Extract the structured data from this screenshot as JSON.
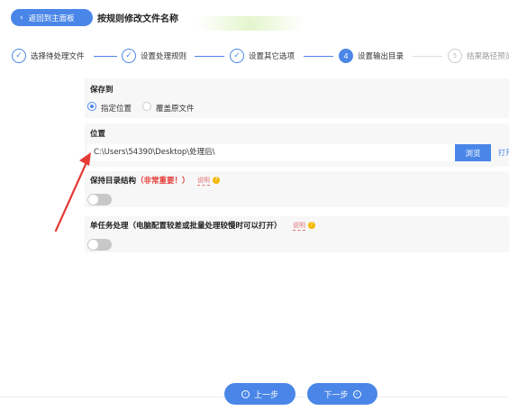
{
  "header": {
    "back_label": "返回到主面板",
    "title": "按规则修改文件名称"
  },
  "steps": [
    {
      "index": "✓",
      "label": "选择待处理文件",
      "state": "done"
    },
    {
      "index": "✓",
      "label": "设置处理规则",
      "state": "done"
    },
    {
      "index": "✓",
      "label": "设置其它选项",
      "state": "done"
    },
    {
      "index": "4",
      "label": "设置输出目录",
      "state": "active"
    },
    {
      "index": "5",
      "label": "结果路径预览",
      "state": "pending"
    }
  ],
  "save_to": {
    "title": "保存到",
    "options": [
      "指定位置",
      "覆盖原文件"
    ],
    "selected": "指定位置"
  },
  "location": {
    "title": "位置",
    "path": "C:\\Users\\54390\\Desktop\\处理后\\",
    "browse_label": "浏览",
    "open_label": "打开"
  },
  "keep_structure": {
    "title": "保持目录结构",
    "warning": "（非常重要！）",
    "hint": "说明",
    "enabled": false
  },
  "single_task": {
    "title": "单任务处理（电脑配置较差或批量处理较慢时可以打开）",
    "hint": "说明",
    "enabled": false
  },
  "footer": {
    "prev_label": "上一步",
    "next_label": "下一步"
  },
  "colors": {
    "accent": "#4a86e8",
    "warning": "#e53935",
    "annotation_arrow": "#e53935"
  }
}
